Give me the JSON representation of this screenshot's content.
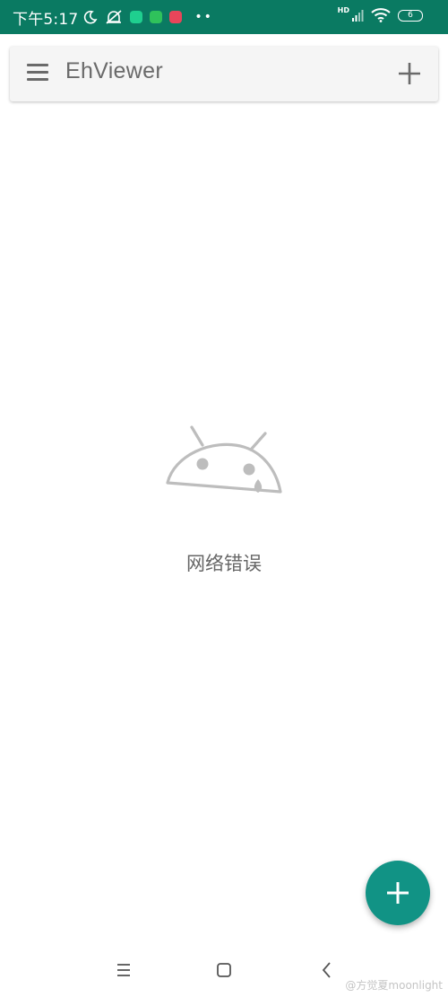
{
  "status_bar": {
    "time": "下午5:17",
    "network_label": "HD",
    "battery_level": "6",
    "color": "#0a7a62"
  },
  "toolbar": {
    "title": "EhViewer",
    "menu_icon": "hamburger-menu-icon",
    "add_icon": "plus-icon"
  },
  "error": {
    "illustration": "sad-android-head-icon",
    "message": "网络错误"
  },
  "fab": {
    "icon": "plus-icon",
    "color": "#119385"
  },
  "nav_bar": {
    "buttons": [
      "recents-button",
      "home-button",
      "back-button"
    ]
  },
  "watermark": "@方觉夏moonlight"
}
